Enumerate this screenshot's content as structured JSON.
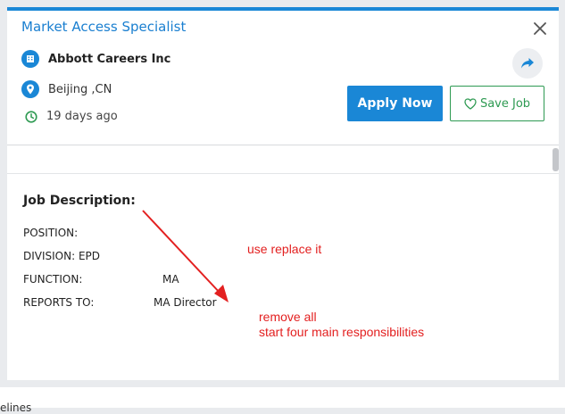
{
  "job": {
    "title": "Market Access Specialist",
    "company": "Abbott Careers Inc",
    "location": "Beijing ,CN",
    "posted": "19 days ago"
  },
  "actions": {
    "apply_label": "Apply Now",
    "save_label": "Save Job"
  },
  "description": {
    "heading": "Job Description:",
    "fields": [
      {
        "label": "POSITION:",
        "value": ""
      },
      {
        "label": "DIVISION: EPD",
        "value": ""
      },
      {
        "label": "FUNCTION:",
        "value": "MA"
      },
      {
        "label": "REPORTS TO:",
        "value": "MA Director"
      }
    ]
  },
  "annotations": {
    "note1": "use replace it",
    "note2_line1": "remove all",
    "note2_line2": "start four main responsibilities"
  },
  "page_footer": {
    "partial_text": "elines"
  },
  "icons": {
    "close": "close-icon",
    "building": "building-icon",
    "location": "map-pin-icon",
    "clock": "clock-icon",
    "share": "share-icon",
    "heart": "heart-icon"
  },
  "colors": {
    "accent": "#1a87d6",
    "save_green": "#2e9a52",
    "annotation_red": "#e32020"
  }
}
